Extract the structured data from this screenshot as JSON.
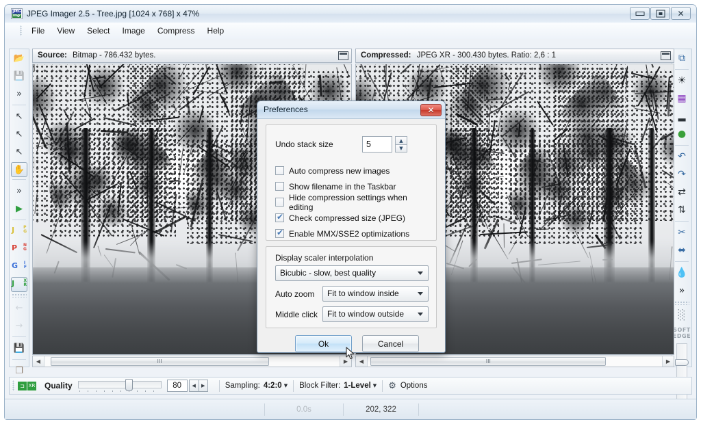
{
  "window": {
    "title": "JPEG Imager 2.5 - Tree.jpg [1024 x 768] x 47%",
    "app_icon": "jpeg-imager-icon",
    "icon_text_top": "JPEG",
    "icon_text_bottom": "imgr",
    "controls": {
      "minimize": "minimize-button",
      "maximize": "restore-button",
      "close": "close-button"
    }
  },
  "menu": {
    "items": [
      {
        "label": "File"
      },
      {
        "label": "View"
      },
      {
        "label": "Select"
      },
      {
        "label": "Image"
      },
      {
        "label": "Compress"
      },
      {
        "label": "Help"
      }
    ]
  },
  "toolbar_left": {
    "items": [
      {
        "name": "open-file",
        "glyph": "📂",
        "color": "#d79a2b",
        "state": "enabled"
      },
      {
        "name": "save-file",
        "glyph": "💾",
        "color": "#9aa3ab",
        "state": "disabled"
      },
      {
        "name": "more-file-actions",
        "glyph": "»",
        "color": "#3a4148",
        "state": "enabled"
      },
      {
        "name": "rectangle-select-tool",
        "glyph": "↖",
        "color": "#33383d",
        "state": "enabled"
      },
      {
        "name": "lasso-select-tool",
        "glyph": "↖",
        "color": "#33383d",
        "state": "enabled"
      },
      {
        "name": "magic-wand-select-tool",
        "glyph": "↖",
        "color": "#33383d",
        "state": "enabled"
      },
      {
        "name": "pan-hand-tool",
        "glyph": "✋",
        "color": "#33383d",
        "state": "selected"
      },
      {
        "name": "more-select-actions",
        "glyph": "»",
        "color": "#3a4148",
        "state": "enabled"
      },
      {
        "name": "compress-now-button",
        "glyph": "▶",
        "color": "#2f9e3f",
        "state": "enabled"
      },
      {
        "name": "format-jpg-button",
        "left": "J",
        "right_top": "P",
        "right_bottom": "G",
        "color": "#d8c03a",
        "state": "enabled"
      },
      {
        "name": "format-png-button",
        "left": "P",
        "right_top": "N",
        "right_bottom": "G",
        "color": "#d8443a",
        "state": "enabled"
      },
      {
        "name": "format-gif-button",
        "left": "G",
        "right_top": "I",
        "right_bottom": "F",
        "color": "#3a6fd8",
        "state": "enabled"
      },
      {
        "name": "format-jxr-button",
        "left": "J",
        "right_top": "X",
        "right_bottom": "R",
        "color": "#2f9e3f",
        "state": "selected"
      },
      {
        "name": "previous-image-button",
        "glyph": "←",
        "color": "#9aa3ab",
        "state": "disabled"
      },
      {
        "name": "next-image-button",
        "glyph": "→",
        "color": "#9aa3ab",
        "state": "disabled"
      },
      {
        "name": "export-image-button",
        "glyph": "💾",
        "color": "#8a5a2b",
        "state": "enabled"
      },
      {
        "name": "batch-process-button",
        "glyph": "❐",
        "color": "#8a7a6b",
        "state": "enabled"
      }
    ]
  },
  "toolbar_right": {
    "soft_edge_label_line1": "SOFT",
    "soft_edge_label_line2": "EDGE",
    "items": [
      {
        "name": "copy-to-clipboard-button",
        "glyph": "⧉",
        "color": "#3b6ea5"
      },
      {
        "name": "brightness-contrast-button",
        "glyph": "☀",
        "color": "#2b3238"
      },
      {
        "name": "color-palette-button",
        "glyph": "▦",
        "color": "#8b3fbf"
      },
      {
        "name": "histogram-button",
        "glyph": "▂",
        "color": "#2b3238"
      },
      {
        "name": "color-wheel-button",
        "glyph": "●",
        "color": "#3aa03a"
      },
      {
        "name": "rotate-left-button",
        "glyph": "↶",
        "color": "#3b6ea5"
      },
      {
        "name": "rotate-right-button",
        "glyph": "↷",
        "color": "#3b6ea5"
      },
      {
        "name": "flip-horizontal-button",
        "glyph": "⇄",
        "color": "#2b3238"
      },
      {
        "name": "flip-vertical-button",
        "glyph": "⇅",
        "color": "#2b3238"
      },
      {
        "name": "crop-button",
        "glyph": "✂",
        "color": "#3b6ea5"
      },
      {
        "name": "resize-image-button",
        "glyph": "⬌",
        "color": "#3b6ea5"
      },
      {
        "name": "blur-water-button",
        "glyph": "💧",
        "color": "#2f86d8"
      },
      {
        "name": "more-effects-button",
        "glyph": "»",
        "color": "#2b3238"
      },
      {
        "name": "noise-texture-button",
        "glyph": "░",
        "color": "#8f99a3"
      }
    ],
    "soft_edge_slider_value": ""
  },
  "panes": {
    "source": {
      "label": "Source:",
      "info": "Bitmap - 786.432 bytes.",
      "maximize_button": "maximize-pane-button",
      "scroll_thumb_grip": "III"
    },
    "compressed": {
      "label": "Compressed:",
      "info": "JPEG XR - 300.430 bytes. Ratio: 2,6 : 1",
      "maximize_button": "maximize-pane-button",
      "scroll_thumb_grip": "III"
    }
  },
  "bottom_toolbar": {
    "quality_label": "Quality",
    "quality_value": "80",
    "quality_slider_percent": 62,
    "sampling_label": "Sampling:",
    "sampling_value": "4:2:0",
    "block_filter_label": "Block Filter:",
    "block_filter_value": "1-Level",
    "options_label": "Options",
    "options_icon": "gear-icon",
    "quality_icon": "jpeg-quality-icon"
  },
  "statusbar": {
    "cells": [
      {
        "name": "status-message",
        "text": ""
      },
      {
        "name": "status-elapsed-time",
        "text": "0.0s"
      },
      {
        "name": "status-coordinates",
        "text": "202, 322"
      },
      {
        "name": "status-extra",
        "text": ""
      }
    ]
  },
  "preferences_dialog": {
    "title": "Preferences",
    "close_button": "close-dialog-button",
    "undo_stack": {
      "label": "Undo stack size",
      "value": "5",
      "spinner_up": "spinner-up",
      "spinner_down": "spinner-down"
    },
    "checkboxes": [
      {
        "label": "Auto compress new images",
        "checked": false,
        "name": "auto-compress-new-images"
      },
      {
        "label": "Show filename in the Taskbar",
        "checked": false,
        "name": "show-filename-in-taskbar"
      },
      {
        "label": "Hide compression settings when editing",
        "checked": false,
        "name": "hide-compression-settings"
      },
      {
        "label": "Check compressed size (JPEG)",
        "checked": true,
        "name": "check-compressed-size"
      },
      {
        "label": "Enable MMX/SSE2 optimizations",
        "checked": true,
        "name": "enable-mmx-sse2"
      }
    ],
    "display_group": {
      "title": "Display scaler interpolation",
      "interpolation_value": "Bicubic - slow, best quality",
      "auto_zoom_label": "Auto zoom",
      "auto_zoom_value": "Fit to window inside",
      "middle_click_label": "Middle click",
      "middle_click_value": "Fit to window outside"
    },
    "buttons": {
      "ok": "Ok",
      "cancel": "Cancel"
    }
  },
  "colors": {
    "accent": "#4a7bb5",
    "close_red": "#c63a2c",
    "title_text": "#10222f"
  }
}
